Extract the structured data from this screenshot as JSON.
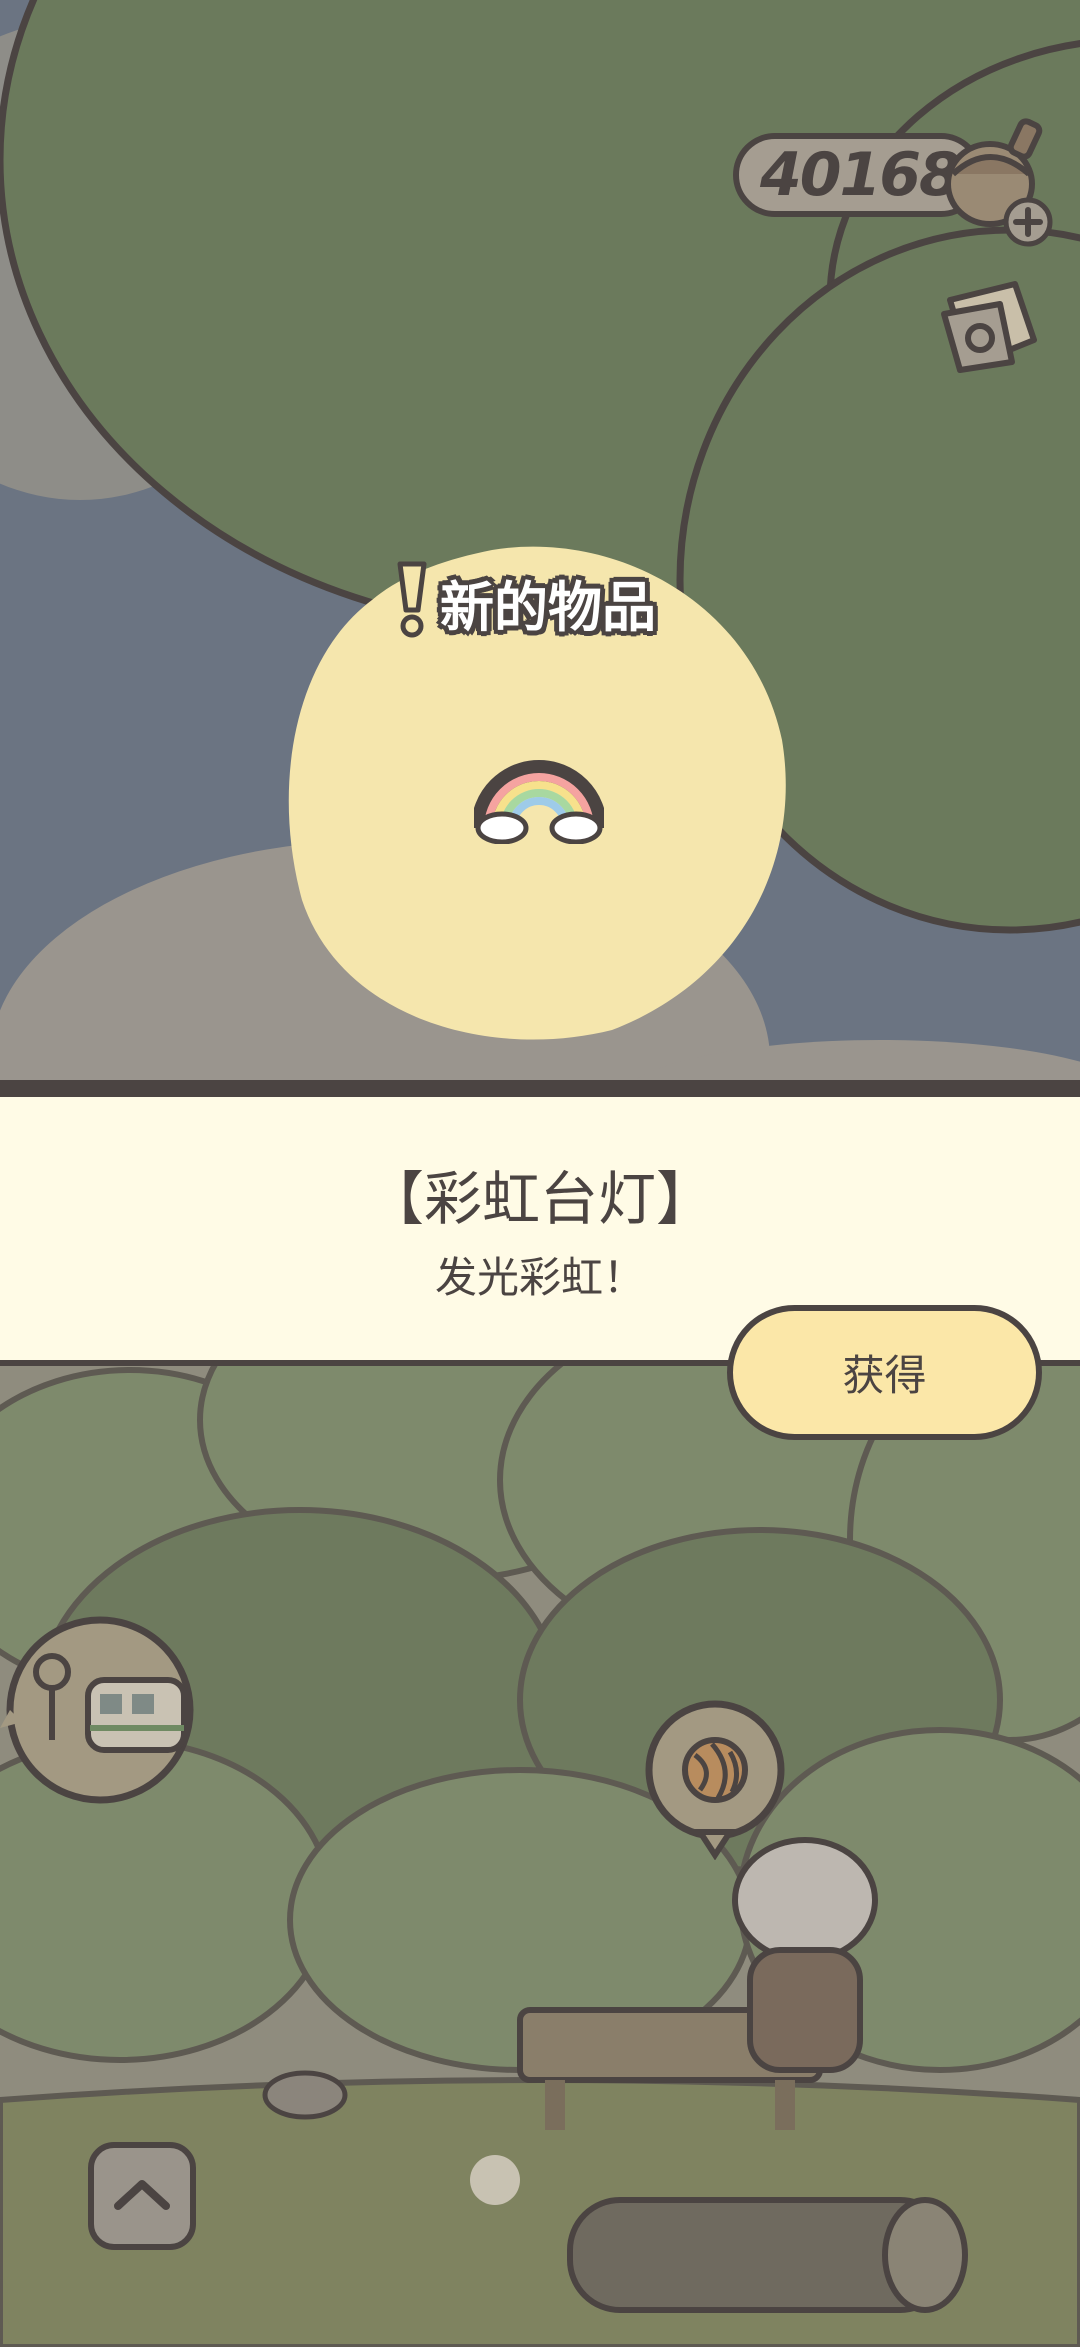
{
  "hud": {
    "currency_value": "401689",
    "currency_icon": "acorn-icon",
    "add_icon": "plus-icon",
    "mail_icon": "mail-icon"
  },
  "reward": {
    "new_item_label": "新的物品",
    "item_name": "【彩虹台灯】",
    "item_description": "发光彩虹！",
    "item_icon": "rainbow-lamp-icon",
    "obtain_label": "获得"
  },
  "scene": {
    "map_stop_icon": "train-stop-icon",
    "craft_icon": "yarn-ball-icon",
    "up_icon": "chevron-up-icon"
  },
  "colors": {
    "outline": "#4b4442",
    "banner_bg": "#fffbe6",
    "button_bg": "#fbe7a8",
    "spotlight": "#f5e6ad",
    "leaf_dark": "#6b7a5c"
  }
}
